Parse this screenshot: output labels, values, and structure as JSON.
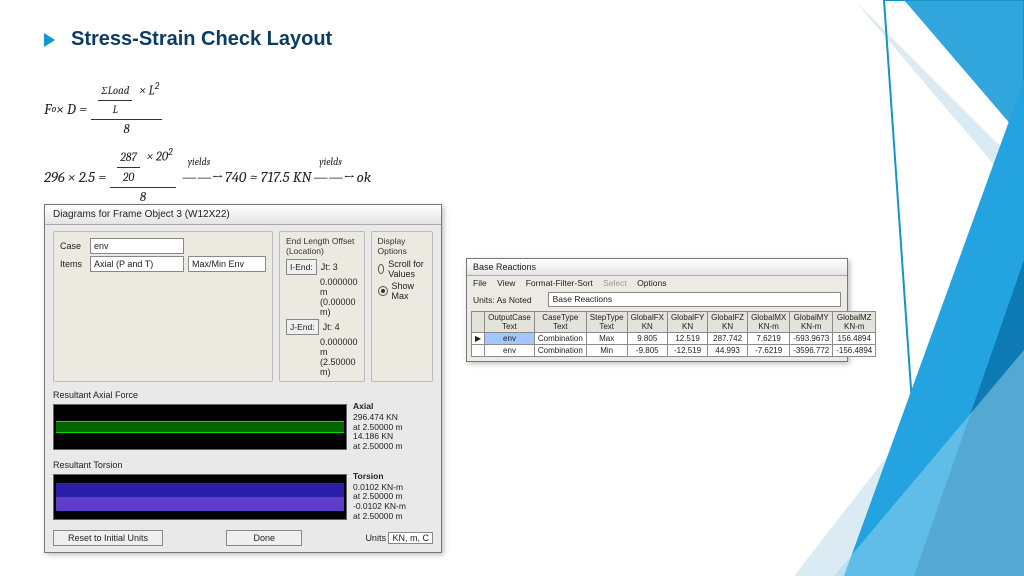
{
  "title": "Stress-Strain Check Layout",
  "math": {
    "lhs1": "F",
    "lhs1sub": "o",
    "xD": " × D = ",
    "frac1_num": "ΣLoad",
    "frac1_den": "L",
    "xL2": " × L",
    "sup2": "2",
    "over8a": "8",
    "lhs2a": "296 × 2.5 = ",
    "frac2_num_a": "287",
    "frac2_num_b": "20",
    "frac2_xp": " × 20",
    "frac2_sup": "2",
    "frac2_den": "8",
    "yields": "yields",
    "arrow": "→",
    "res1": " 740 ≈ 717.5 KN ",
    "res2": " ok"
  },
  "diagrams": {
    "window_title": "Diagrams for Frame Object 3  (W12X22)",
    "case_lbl": "Case",
    "case_val": "env",
    "items_lbl": "Items",
    "items_val": "Axial (P and T)",
    "items_mode": "Max/Min Env",
    "offset_title": "End Length Offset (Location)",
    "iend_btn": "I-End:",
    "iend_jt": "Jt: 3",
    "iend_v1": "0.000000 m",
    "iend_v2": "(0.00000 m)",
    "jend_btn": "J-End:",
    "jend_jt": "Jt: 4",
    "jend_v1": "0.000000 m",
    "jend_v2": "(2.50000 m)",
    "disp_title": "Display Options",
    "disp_scroll": "Scroll for Values",
    "disp_show": "Show Max",
    "axial_title": "Resultant Axial Force",
    "axial_h": "Axial",
    "axial_l1": "296.474 KN",
    "axial_l2": "at 2.50000 m",
    "axial_l3": "14.186 KN",
    "axial_l4": "at 2.50000 m",
    "tor_title": "Resultant Torsion",
    "tor_h": "Torsion",
    "tor_l1": "0.0102 KN-m",
    "tor_l2": "at 2.50000 m",
    "tor_l3": "-0.0102 KN-m",
    "tor_l4": "at 2.50000 m",
    "reset": "Reset to Initial Units",
    "done": "Done",
    "units_lbl": "Units",
    "units_val": "KN, m, C"
  },
  "reactions": {
    "window_title": "Base Reactions",
    "menu": {
      "file": "File",
      "view": "View",
      "fmt": "Format-Filter-Sort",
      "select": "Select",
      "opt": "Options"
    },
    "units_lbl": "Units: As Noted",
    "sel_val": "Base Reactions",
    "headers": [
      "",
      "OutputCase\nText",
      "CaseType\nText",
      "StepType\nText",
      "GlobalFX\nKN",
      "GlobalFY\nKN",
      "GlobalFZ\nKN",
      "GlobalMX\nKN-m",
      "GlobalMY\nKN-m",
      "GlobalMZ\nKN-m"
    ],
    "row1": [
      "▶",
      "env",
      "Combination",
      "Max",
      "9.805",
      "12.519",
      "287.742",
      "7.6219",
      "-593.9673",
      "156.4894"
    ],
    "row2": [
      "",
      "env",
      "Combination",
      "Min",
      "-9.805",
      "-12.519",
      "44.993",
      "-7.6219",
      "-3596.772",
      "-156.4894"
    ]
  },
  "chart_data": [
    {
      "type": "bar",
      "title": "Resultant Axial Force",
      "series": [
        {
          "name": "Axial",
          "values": [
            296.474,
            14.186
          ]
        }
      ],
      "categories": [
        "max@2.5m",
        "min@2.5m"
      ],
      "ylabel": "KN"
    },
    {
      "type": "bar",
      "title": "Resultant Torsion",
      "series": [
        {
          "name": "Torsion",
          "values": [
            0.0102,
            -0.0102
          ]
        }
      ],
      "categories": [
        "max@2.5m",
        "min@2.5m"
      ],
      "ylabel": "KN-m"
    }
  ]
}
